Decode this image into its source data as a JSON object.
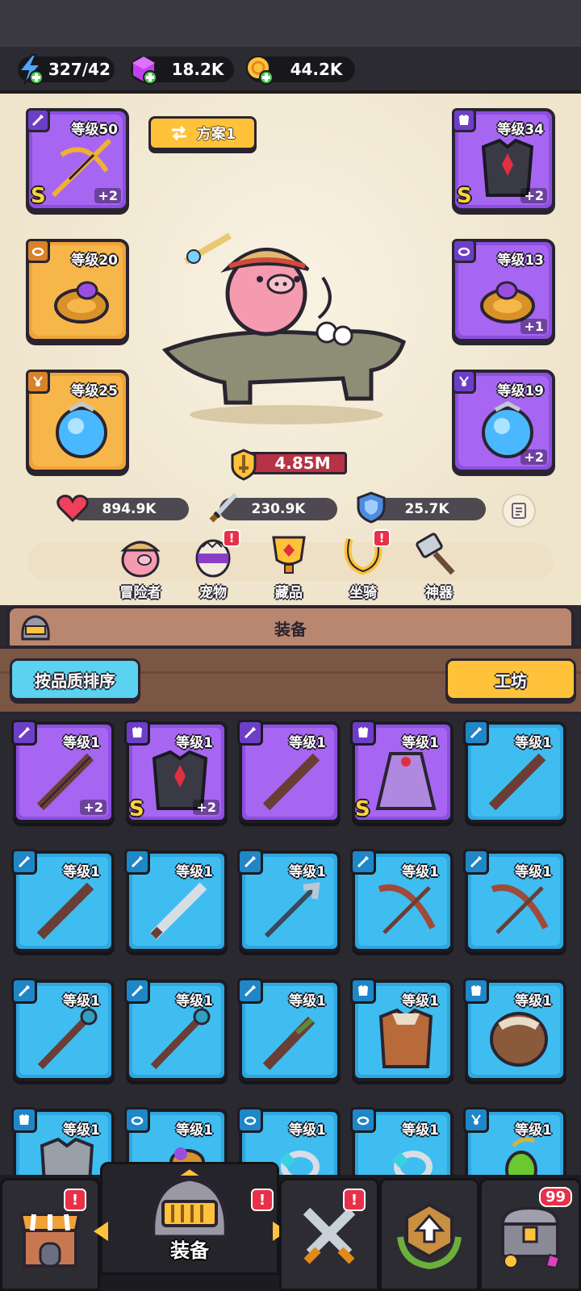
{
  "resources": {
    "energy": "327/42",
    "gems": "18.2K",
    "gold": "44.2K"
  },
  "plan_label": "方案1",
  "equipped": {
    "weapon": {
      "level": "等级50",
      "plus": "+2",
      "rank": "S"
    },
    "armor": {
      "level": "等级34",
      "plus": "+2",
      "rank": "S"
    },
    "ring_left": {
      "level": "等级20"
    },
    "ring_right": {
      "level": "等级13",
      "plus": "+1"
    },
    "amulet_left": {
      "level": "等级25"
    },
    "amulet_right": {
      "level": "等级19",
      "plus": "+2"
    }
  },
  "power": "4.85M",
  "stats": {
    "hp": "894.9K",
    "attack": "230.9K",
    "defense": "25.7K"
  },
  "tabs": [
    {
      "label": "冒险者",
      "alert": false
    },
    {
      "label": "宠物",
      "alert": true
    },
    {
      "label": "藏品",
      "alert": false
    },
    {
      "label": "坐骑",
      "alert": true
    },
    {
      "label": "神器",
      "alert": false
    }
  ],
  "alert_mark": "!",
  "section_title": "装备",
  "sort_button": "按品质排序",
  "workshop_button": "工坊",
  "inventory": [
    {
      "level": "等级1",
      "plus": "+2",
      "rank": ""
    },
    {
      "level": "等级1",
      "plus": "+2",
      "rank": "S"
    },
    {
      "level": "等级1",
      "plus": "",
      "rank": ""
    },
    {
      "level": "等级1",
      "plus": "",
      "rank": "S"
    },
    {
      "level": "等级1",
      "plus": "",
      "rank": ""
    },
    {
      "level": "等级1"
    },
    {
      "level": "等级1"
    },
    {
      "level": "等级1"
    },
    {
      "level": "等级1"
    },
    {
      "level": "等级1"
    },
    {
      "level": "等级1"
    },
    {
      "level": "等级1"
    },
    {
      "level": "等级1"
    },
    {
      "level": "等级1"
    },
    {
      "level": "等级1"
    },
    {
      "level": "等级1"
    },
    {
      "level": "等级1"
    },
    {
      "level": "等级1"
    },
    {
      "level": "等级1"
    },
    {
      "level": "等级1"
    }
  ],
  "nav": {
    "active_label": "装备",
    "chest_count": "99"
  }
}
